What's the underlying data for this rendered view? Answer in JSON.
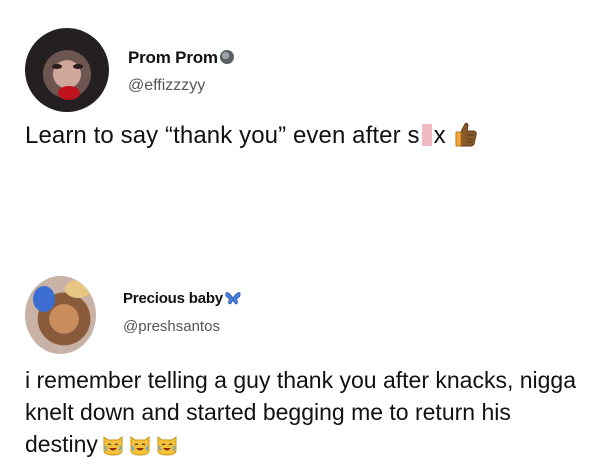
{
  "tweets": [
    {
      "display_name": "Prom Prom",
      "handle": "@effizzzyy",
      "text_before_censor": "Learn to say “thank you” even after s",
      "text_after_censor": "x",
      "badge_icon": "moon-badge-icon",
      "emoji": "thumbs-up-icon"
    },
    {
      "display_name": "Precious baby",
      "handle": "@preshsantos",
      "text": "i remember telling a guy thank you after knacks, nigga knelt down and started begging me to return his destiny",
      "name_icon": "butterfly-icon",
      "emojis": [
        "cat-laughing-icon",
        "cat-laughing-icon",
        "cat-laughing-icon"
      ]
    }
  ],
  "colors": {
    "censor": "#f1b9c2",
    "handle": "#555555",
    "text": "#111111"
  }
}
